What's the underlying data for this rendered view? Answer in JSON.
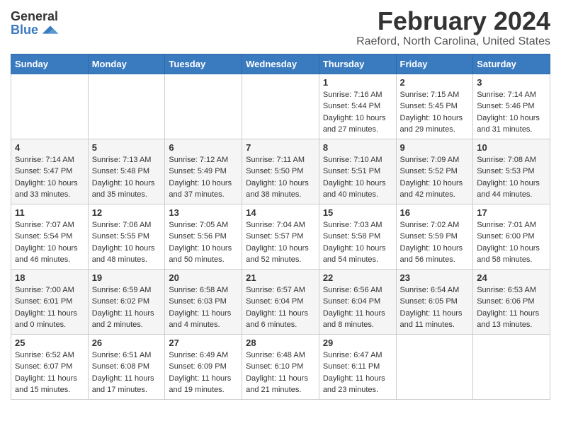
{
  "logo": {
    "general": "General",
    "blue": "Blue"
  },
  "title": {
    "month": "February 2024",
    "location": "Raeford, North Carolina, United States"
  },
  "days_of_week": [
    "Sunday",
    "Monday",
    "Tuesday",
    "Wednesday",
    "Thursday",
    "Friday",
    "Saturday"
  ],
  "weeks": [
    [
      {
        "day": "",
        "info": ""
      },
      {
        "day": "",
        "info": ""
      },
      {
        "day": "",
        "info": ""
      },
      {
        "day": "",
        "info": ""
      },
      {
        "day": "1",
        "info": "Sunrise: 7:16 AM\nSunset: 5:44 PM\nDaylight: 10 hours and 27 minutes."
      },
      {
        "day": "2",
        "info": "Sunrise: 7:15 AM\nSunset: 5:45 PM\nDaylight: 10 hours and 29 minutes."
      },
      {
        "day": "3",
        "info": "Sunrise: 7:14 AM\nSunset: 5:46 PM\nDaylight: 10 hours and 31 minutes."
      }
    ],
    [
      {
        "day": "4",
        "info": "Sunrise: 7:14 AM\nSunset: 5:47 PM\nDaylight: 10 hours and 33 minutes."
      },
      {
        "day": "5",
        "info": "Sunrise: 7:13 AM\nSunset: 5:48 PM\nDaylight: 10 hours and 35 minutes."
      },
      {
        "day": "6",
        "info": "Sunrise: 7:12 AM\nSunset: 5:49 PM\nDaylight: 10 hours and 37 minutes."
      },
      {
        "day": "7",
        "info": "Sunrise: 7:11 AM\nSunset: 5:50 PM\nDaylight: 10 hours and 38 minutes."
      },
      {
        "day": "8",
        "info": "Sunrise: 7:10 AM\nSunset: 5:51 PM\nDaylight: 10 hours and 40 minutes."
      },
      {
        "day": "9",
        "info": "Sunrise: 7:09 AM\nSunset: 5:52 PM\nDaylight: 10 hours and 42 minutes."
      },
      {
        "day": "10",
        "info": "Sunrise: 7:08 AM\nSunset: 5:53 PM\nDaylight: 10 hours and 44 minutes."
      }
    ],
    [
      {
        "day": "11",
        "info": "Sunrise: 7:07 AM\nSunset: 5:54 PM\nDaylight: 10 hours and 46 minutes."
      },
      {
        "day": "12",
        "info": "Sunrise: 7:06 AM\nSunset: 5:55 PM\nDaylight: 10 hours and 48 minutes."
      },
      {
        "day": "13",
        "info": "Sunrise: 7:05 AM\nSunset: 5:56 PM\nDaylight: 10 hours and 50 minutes."
      },
      {
        "day": "14",
        "info": "Sunrise: 7:04 AM\nSunset: 5:57 PM\nDaylight: 10 hours and 52 minutes."
      },
      {
        "day": "15",
        "info": "Sunrise: 7:03 AM\nSunset: 5:58 PM\nDaylight: 10 hours and 54 minutes."
      },
      {
        "day": "16",
        "info": "Sunrise: 7:02 AM\nSunset: 5:59 PM\nDaylight: 10 hours and 56 minutes."
      },
      {
        "day": "17",
        "info": "Sunrise: 7:01 AM\nSunset: 6:00 PM\nDaylight: 10 hours and 58 minutes."
      }
    ],
    [
      {
        "day": "18",
        "info": "Sunrise: 7:00 AM\nSunset: 6:01 PM\nDaylight: 11 hours and 0 minutes."
      },
      {
        "day": "19",
        "info": "Sunrise: 6:59 AM\nSunset: 6:02 PM\nDaylight: 11 hours and 2 minutes."
      },
      {
        "day": "20",
        "info": "Sunrise: 6:58 AM\nSunset: 6:03 PM\nDaylight: 11 hours and 4 minutes."
      },
      {
        "day": "21",
        "info": "Sunrise: 6:57 AM\nSunset: 6:04 PM\nDaylight: 11 hours and 6 minutes."
      },
      {
        "day": "22",
        "info": "Sunrise: 6:56 AM\nSunset: 6:04 PM\nDaylight: 11 hours and 8 minutes."
      },
      {
        "day": "23",
        "info": "Sunrise: 6:54 AM\nSunset: 6:05 PM\nDaylight: 11 hours and 11 minutes."
      },
      {
        "day": "24",
        "info": "Sunrise: 6:53 AM\nSunset: 6:06 PM\nDaylight: 11 hours and 13 minutes."
      }
    ],
    [
      {
        "day": "25",
        "info": "Sunrise: 6:52 AM\nSunset: 6:07 PM\nDaylight: 11 hours and 15 minutes."
      },
      {
        "day": "26",
        "info": "Sunrise: 6:51 AM\nSunset: 6:08 PM\nDaylight: 11 hours and 17 minutes."
      },
      {
        "day": "27",
        "info": "Sunrise: 6:49 AM\nSunset: 6:09 PM\nDaylight: 11 hours and 19 minutes."
      },
      {
        "day": "28",
        "info": "Sunrise: 6:48 AM\nSunset: 6:10 PM\nDaylight: 11 hours and 21 minutes."
      },
      {
        "day": "29",
        "info": "Sunrise: 6:47 AM\nSunset: 6:11 PM\nDaylight: 11 hours and 23 minutes."
      },
      {
        "day": "",
        "info": ""
      },
      {
        "day": "",
        "info": ""
      }
    ]
  ]
}
